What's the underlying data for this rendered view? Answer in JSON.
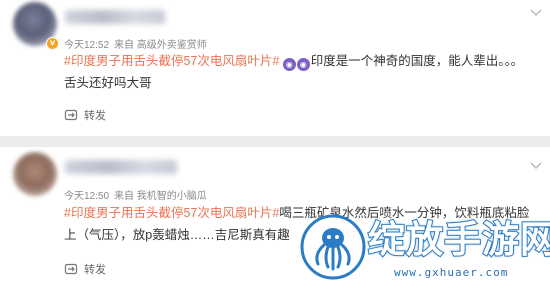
{
  "comments": [
    {
      "meta": {
        "time": "今天12:52",
        "source": "来自 高级外卖鉴赏师"
      },
      "hashtag": "#印度男子用舌头截停57次电风扇叶片#",
      "emojis": [
        "◉",
        "◉"
      ],
      "text": "印度是一个神奇的国度，能人辈出。。。",
      "line2": "舌头还好吗大哥",
      "repost_label": "转发"
    },
    {
      "meta": {
        "time": "今天12:50",
        "source": "来自 我机智的小脑瓜"
      },
      "hashtag": "#印度男子用舌头截停57次电风扇叶片#",
      "text": "喝三瓶矿泉水然后喷水一分钟，饮料瓶底粘脸上（气压），放p轰蜡烛……吉尼斯真有趣",
      "repost_label": "转发"
    }
  ],
  "watermark": {
    "title": "绽放手游网",
    "url": "www.gxhuaer.com",
    "color": "#2a7cc4"
  },
  "colors": {
    "hashtag": "#eb7350",
    "meta": "#8a8a8a",
    "background": "#ececec"
  }
}
